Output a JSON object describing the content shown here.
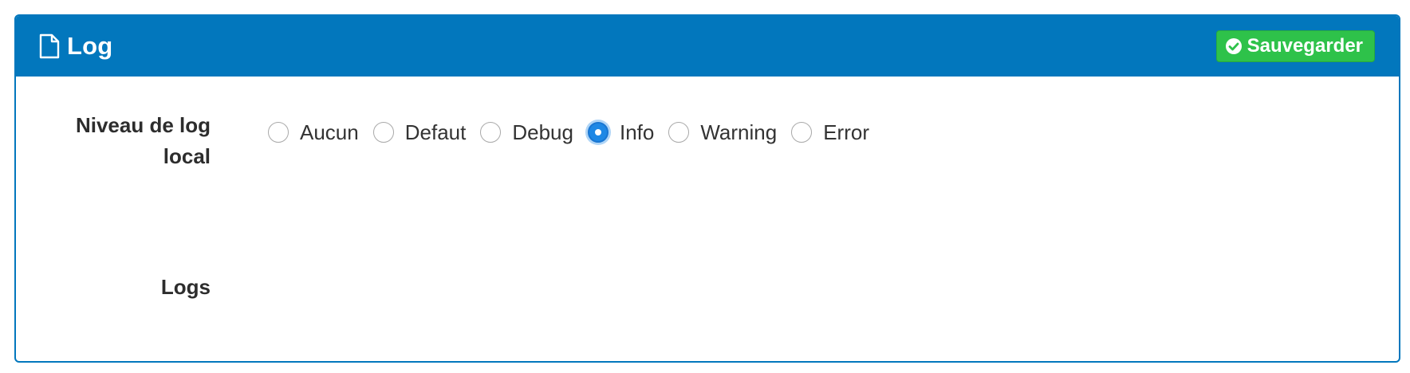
{
  "panel": {
    "title": "Log",
    "title_icon": "file-icon",
    "save_button": {
      "label": "Sauvegarder",
      "icon": "check-circle-icon"
    }
  },
  "form": {
    "log_level": {
      "label": "Niveau de log local",
      "options": [
        "Aucun",
        "Defaut",
        "Debug",
        "Info",
        "Warning",
        "Error"
      ],
      "selected": "Info"
    },
    "logs": {
      "label": "Logs"
    }
  },
  "colors": {
    "header_bg": "#0277bd",
    "save_button_bg": "#2ec24a",
    "radio_selected": "#1e88e5"
  }
}
